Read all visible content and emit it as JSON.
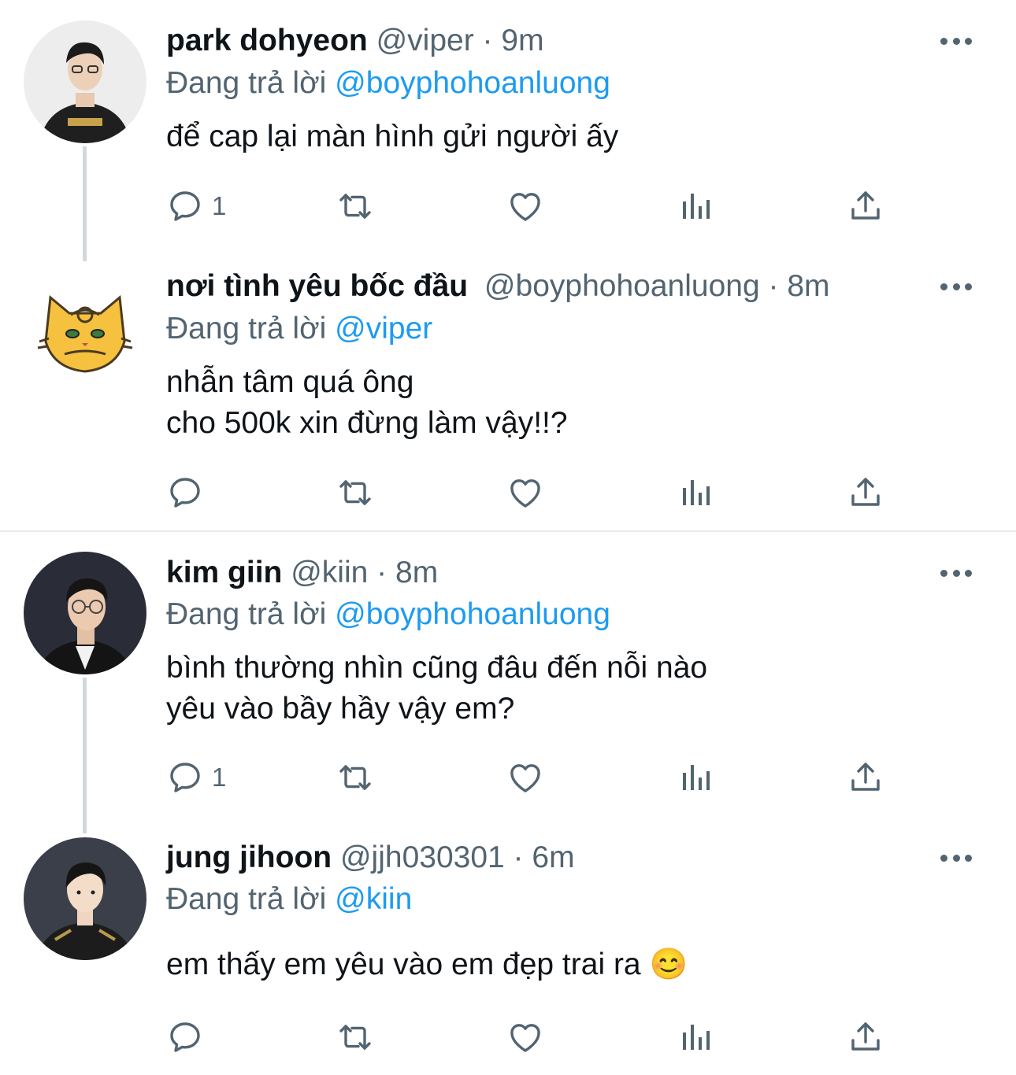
{
  "tweets": [
    {
      "name": "park dohyeon",
      "handle": "@viper",
      "dot": "·",
      "time": "9m",
      "reply_prefix": "Đang trả lời",
      "reply_to": "@boyphohoanluong",
      "text": "để cap lại màn hình gửi người ấy",
      "reply_count": "1",
      "avatar": "person-photo-dark-jacket"
    },
    {
      "name": "nơi tình yêu bốc đầu",
      "handle": "@boyphohoanluong",
      "dot": "·",
      "time": "8m",
      "reply_prefix": "Đang trả lời",
      "reply_to": "@viper",
      "text": "nhẫn tâm quá ông\ncho 500k xin đừng làm vậy!!?",
      "reply_count": "",
      "avatar": "cartoon-tiger-cat"
    },
    {
      "name": "kim giin",
      "handle": "@kiin",
      "dot": "·",
      "time": "8m",
      "reply_prefix": "Đang trả lời",
      "reply_to": "@boyphohoanluong",
      "text": "bình thường nhìn cũng đâu đến nỗi nào\nyêu vào bầy hầy vậy em?",
      "reply_count": "1",
      "avatar": "person-photo-glasses"
    },
    {
      "name": "jung jihoon",
      "handle": "@jjh030301",
      "dot": "·",
      "time": "6m",
      "reply_prefix": "Đang trả lời",
      "reply_to": "@kiin",
      "text": "em thấy em yêu vào em đẹp trai ra 😊",
      "reply_count": "",
      "avatar": "person-photo-jersey"
    }
  ],
  "icons": {
    "reply": "reply-icon",
    "retweet": "retweet-icon",
    "like": "like-icon",
    "views": "views-icon",
    "share": "share-icon",
    "more": "more-icon"
  },
  "colors": {
    "link": "#1d9bf0",
    "secondary": "#536471",
    "text": "#0f1419",
    "thread_line": "#cfd9de"
  }
}
